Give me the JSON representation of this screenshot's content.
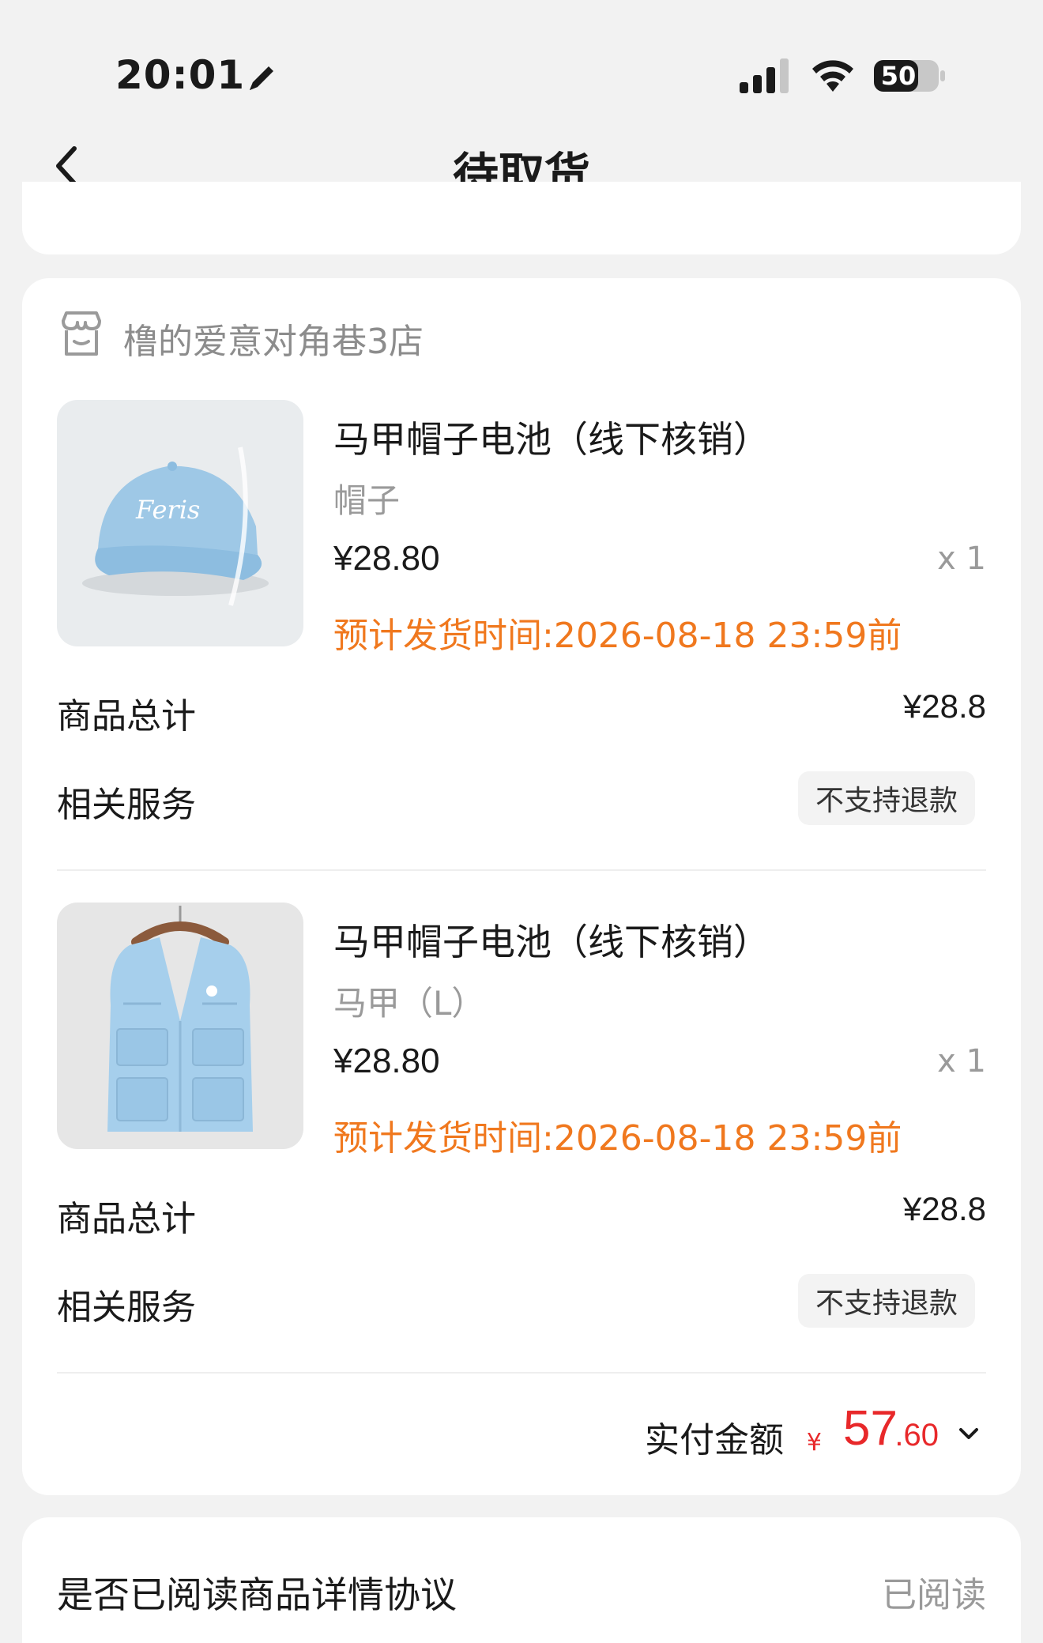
{
  "status_bar": {
    "time": "20:01",
    "battery": "50"
  },
  "nav": {
    "title": "待取货"
  },
  "store": {
    "name": "橹的爱意对角巷3店"
  },
  "items": [
    {
      "name": "马甲帽子电池（线下核销）",
      "spec": "帽子",
      "price": "¥28.80",
      "qty": "x 1",
      "delivery": "预计发货时间:2026-08-18 23:59前",
      "image_icon": "blue-cap-image",
      "total_label": "商品总计",
      "total_value": "¥28.8",
      "service_label": "相关服务",
      "service_tag": "不支持退款"
    },
    {
      "name": "马甲帽子电池（线下核销）",
      "spec": "马甲（L）",
      "price": "¥28.80",
      "qty": "x 1",
      "delivery": "预计发货时间:2026-08-18 23:59前",
      "image_icon": "blue-vest-image",
      "total_label": "商品总计",
      "total_value": "¥28.8",
      "service_label": "相关服务",
      "service_tag": "不支持退款"
    }
  ],
  "payment": {
    "label": "实付金额",
    "currency": "¥",
    "integer": "57",
    "decimal": ".60"
  },
  "agreement": {
    "label": "是否已阅读商品详情协议",
    "status": "已阅读"
  },
  "colors": {
    "accent_orange": "#f0781e",
    "price_red": "#e8282a",
    "background": "#f2f2f2",
    "card": "#ffffff"
  }
}
